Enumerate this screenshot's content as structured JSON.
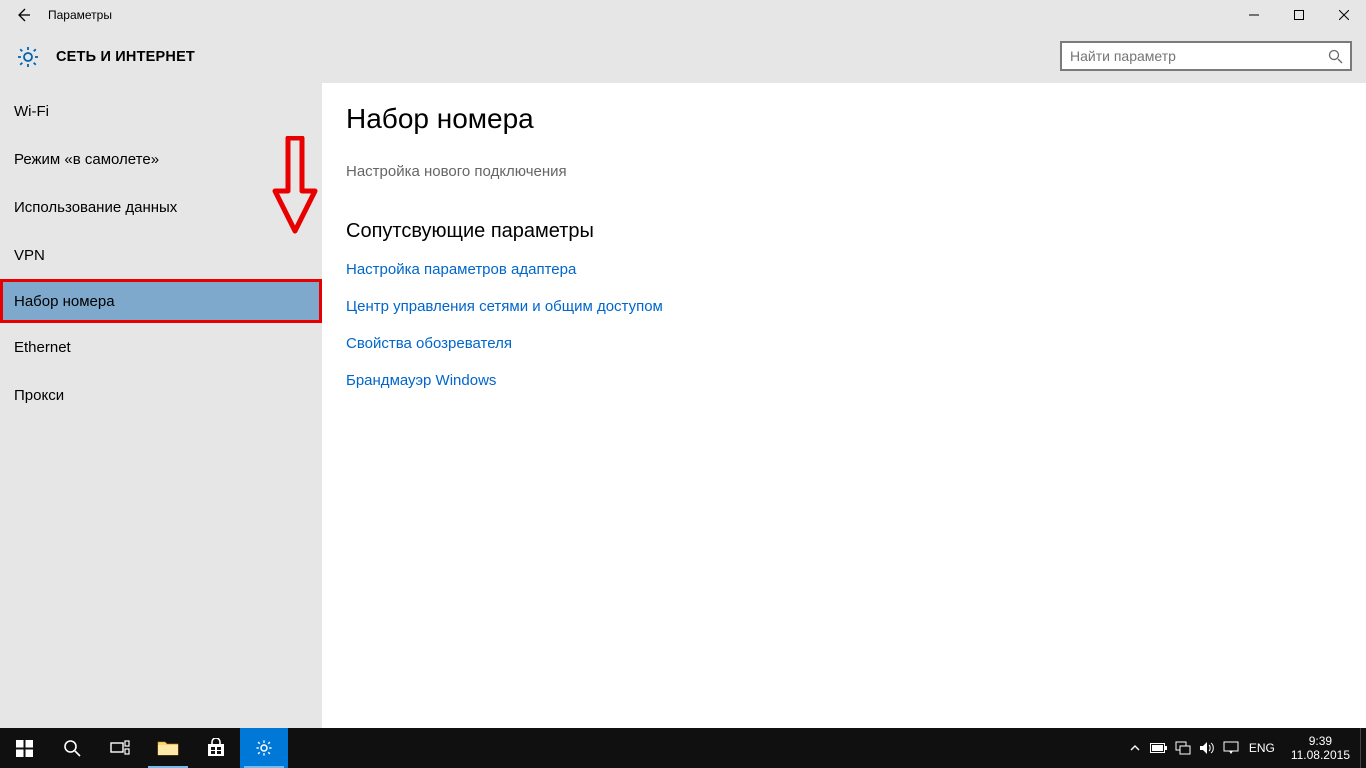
{
  "titlebar": {
    "title": "Параметры"
  },
  "header": {
    "category": "СЕТЬ И ИНТЕРНЕТ",
    "search_placeholder": "Найти параметр"
  },
  "sidebar": {
    "items": [
      {
        "label": "Wi-Fi",
        "selected": false
      },
      {
        "label": "Режим «в самолете»",
        "selected": false
      },
      {
        "label": "Использование данных",
        "selected": false
      },
      {
        "label": "VPN",
        "selected": false
      },
      {
        "label": "Набор номера",
        "selected": true
      },
      {
        "label": "Ethernet",
        "selected": false
      },
      {
        "label": "Прокси",
        "selected": false
      }
    ]
  },
  "content": {
    "title": "Набор номера",
    "new_connection": "Настройка нового подключения",
    "related_heading": "Сопутсвующие параметры",
    "links": [
      "Настройка параметров адаптера",
      "Центр управления сетями и общим доступом",
      "Свойства обозревателя",
      "Брандмауэр Windows"
    ]
  },
  "tray": {
    "lang": "ENG",
    "time": "9:39",
    "date": "11.08.2015"
  },
  "annotation": {
    "color": "#e80000"
  }
}
